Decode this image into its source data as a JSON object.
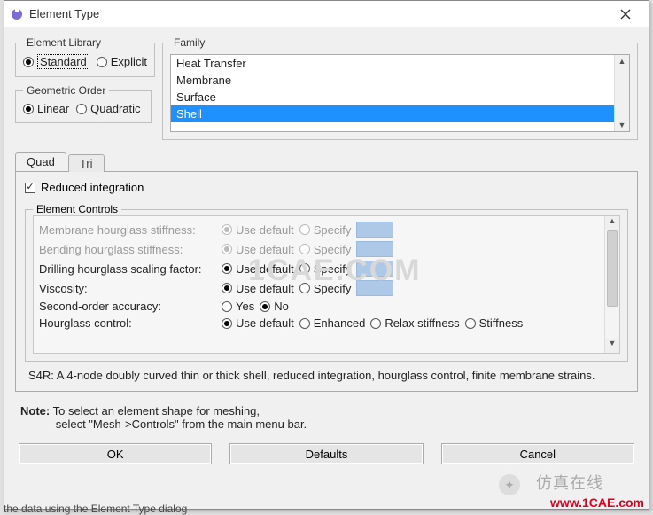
{
  "titlebar": {
    "title": "Element Type"
  },
  "library": {
    "legend": "Element Library",
    "standard": "Standard",
    "explicit": "Explicit"
  },
  "order": {
    "legend": "Geometric Order",
    "linear": "Linear",
    "quadratic": "Quadratic"
  },
  "family": {
    "legend": "Family",
    "items": [
      "Heat Transfer",
      "Membrane",
      "Surface",
      "Shell"
    ],
    "selected_index": 3
  },
  "tabs": {
    "quad": "Quad",
    "tri": "Tri"
  },
  "reduced_integration": "Reduced integration",
  "controls": {
    "legend": "Element Controls",
    "rows": {
      "membrane": {
        "label": "Membrane hourglass stiffness:",
        "opt1": "Use default",
        "opt2": "Specify"
      },
      "bending": {
        "label": "Bending hourglass stiffness:",
        "opt1": "Use default",
        "opt2": "Specify"
      },
      "drilling": {
        "label": "Drilling hourglass scaling factor:",
        "opt1": "Use default",
        "opt2": "Specify"
      },
      "viscosity": {
        "label": "Viscosity:",
        "opt1": "Use default",
        "opt2": "Specify"
      },
      "second": {
        "label": "Second-order accuracy:",
        "opt1": "Yes",
        "opt2": "No"
      },
      "hourglass": {
        "label": "Hourglass control:",
        "opt1": "Use default",
        "opt2": "Enhanced",
        "opt3": "Relax stiffness",
        "opt4": "Stiffness"
      }
    }
  },
  "description": "S4R:  A 4-node doubly curved thin or thick shell, reduced integration, hourglass control, finite membrane strains.",
  "note": {
    "label": "Note:",
    "line1": "To select an element shape for meshing,",
    "line2": "select \"Mesh->Controls\" from the main menu bar."
  },
  "buttons": {
    "ok": "OK",
    "defaults": "Defaults",
    "cancel": "Cancel"
  },
  "partial": "the data using the Element Type dialog",
  "watermarks": {
    "w1": "仿真在线",
    "w2": "www.1CAE.com",
    "w3": "1CAE.COM"
  }
}
